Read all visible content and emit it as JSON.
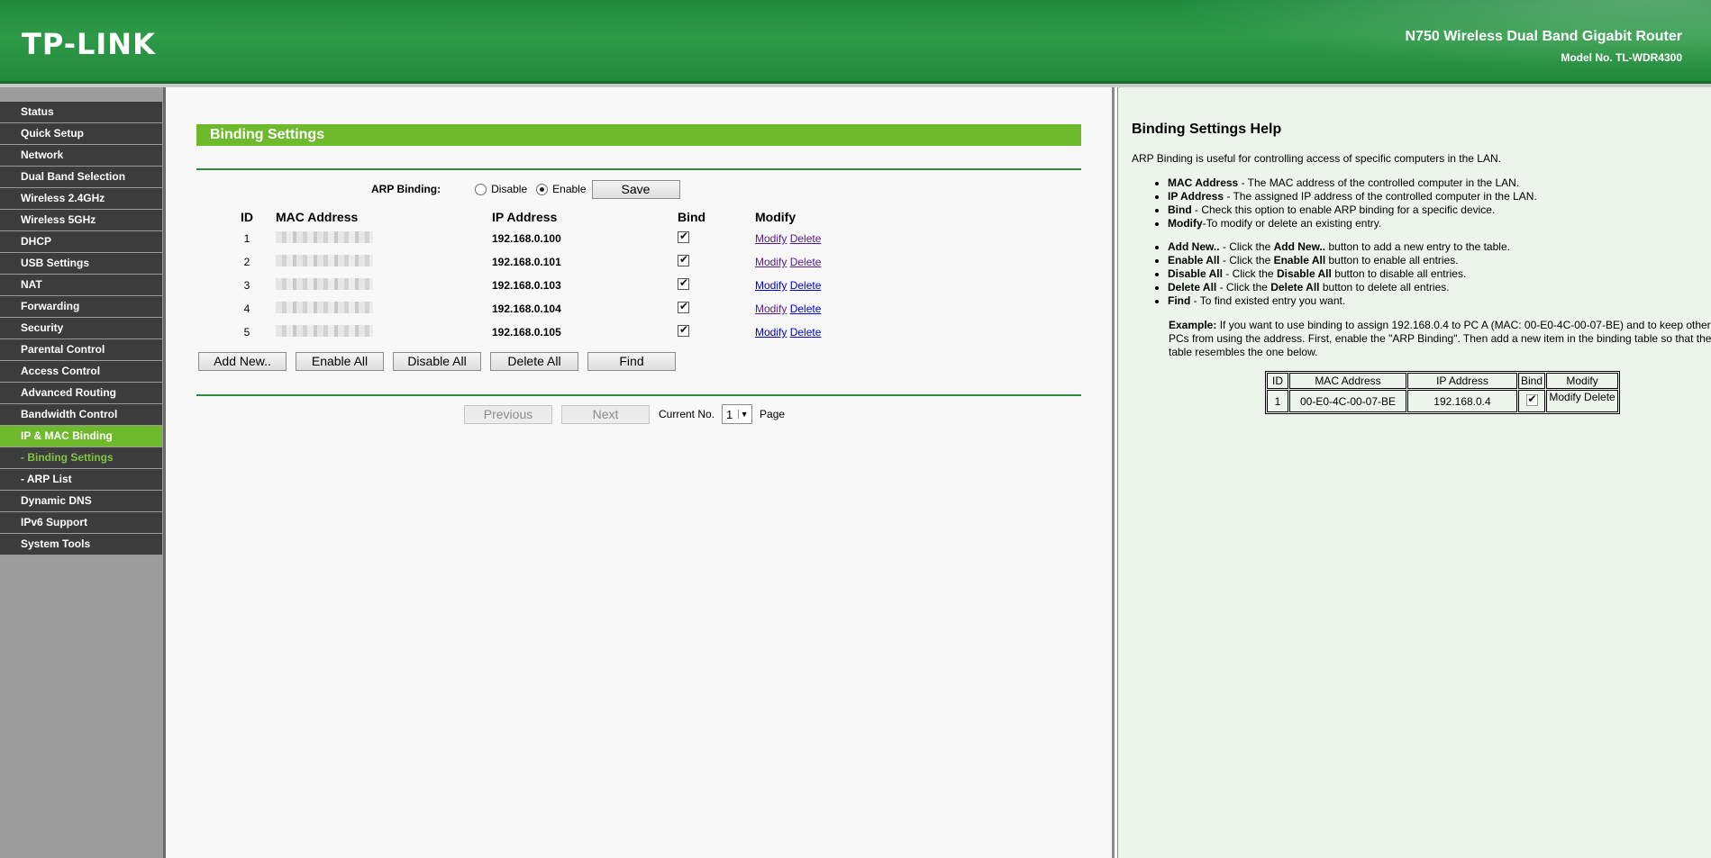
{
  "header": {
    "logo": "TP-LINK",
    "product": "N750 Wireless Dual Band Gigabit Router",
    "model": "Model No. TL-WDR4300"
  },
  "sidebar": {
    "items": [
      {
        "label": "Status"
      },
      {
        "label": "Quick Setup"
      },
      {
        "label": "Network"
      },
      {
        "label": "Dual Band Selection"
      },
      {
        "label": "Wireless 2.4GHz"
      },
      {
        "label": "Wireless 5GHz"
      },
      {
        "label": "DHCP"
      },
      {
        "label": "USB Settings"
      },
      {
        "label": "NAT"
      },
      {
        "label": "Forwarding"
      },
      {
        "label": "Security"
      },
      {
        "label": "Parental Control"
      },
      {
        "label": "Access Control"
      },
      {
        "label": "Advanced Routing"
      },
      {
        "label": "Bandwidth Control"
      },
      {
        "label": "IP & MAC Binding"
      },
      {
        "label": "- Binding Settings"
      },
      {
        "label": "- ARP List"
      },
      {
        "label": "Dynamic DNS"
      },
      {
        "label": "IPv6 Support"
      },
      {
        "label": "System Tools"
      }
    ]
  },
  "main": {
    "title": "Binding Settings",
    "arp_label": "ARP Binding:",
    "disable_label": "Disable",
    "enable_label": "Enable",
    "save_label": "Save",
    "columns": [
      "ID",
      "MAC Address",
      "IP Address",
      "Bind",
      "Modify"
    ],
    "rows": [
      {
        "id": "1",
        "ip": "192.168.0.100"
      },
      {
        "id": "2",
        "ip": "192.168.0.101"
      },
      {
        "id": "3",
        "ip": "192.168.0.103"
      },
      {
        "id": "4",
        "ip": "192.168.0.104"
      },
      {
        "id": "5",
        "ip": "192.168.0.105"
      }
    ],
    "modify_link": "Modify",
    "delete_link": "Delete",
    "add_new_label": "Add New..",
    "enable_all_label": "Enable All",
    "disable_all_label": "Disable All",
    "delete_all_label": "Delete All",
    "find_label": "Find",
    "previous_label": "Previous",
    "next_label": "Next",
    "current_no_label": "Current No.",
    "page_value": "1",
    "page_label": "Page"
  },
  "help": {
    "title": "Binding Settings Help",
    "intro": "ARP Binding is useful for controlling access of specific computers in the LAN.",
    "items1": [
      {
        "term": "MAC Address",
        "desc": " - The MAC address of the controlled computer in the LAN."
      },
      {
        "term": "IP Address",
        "desc": " - The assigned IP address of the controlled computer in the LAN."
      },
      {
        "term": "Bind",
        "desc": " - Check this option to enable ARP binding for a specific device."
      },
      {
        "term": "Modify",
        "desc": "-To modify or delete an existing entry."
      }
    ],
    "items2": [
      {
        "term": "Add New..",
        "mid": " - Click the ",
        "term2": "Add New..",
        "desc": " button to add a new entry to the table."
      },
      {
        "term": "Enable All",
        "mid": " - Click the ",
        "term2": "Enable All",
        "desc": " button to enable all entries."
      },
      {
        "term": "Disable All",
        "mid": " - Click the ",
        "term2": "Disable All",
        "desc": " button to disable all entries."
      },
      {
        "term": "Delete All",
        "mid": " - Click the ",
        "term2": "Delete All",
        "desc": " button to delete all entries."
      },
      {
        "term": "Find",
        "mid": " - To find existed entry you want.",
        "term2": "",
        "desc": ""
      }
    ],
    "example_label": "Example:",
    "example_text": " If you want to use binding to assign 192.168.0.4 to PC A (MAC: 00-E0-4C-00-07-BE) and to keep other PCs from using the address. First, enable the \"ARP Binding\". Then add a new item in the binding table so that the table resembles the one below.",
    "example_table": {
      "columns": [
        "ID",
        "MAC Address",
        "IP Address",
        "Bind",
        "Modify"
      ],
      "id": "1",
      "mac": "00-E0-4C-00-07-BE",
      "ip": "192.168.0.4",
      "modify": "Modify",
      "delete": "Delete"
    }
  }
}
